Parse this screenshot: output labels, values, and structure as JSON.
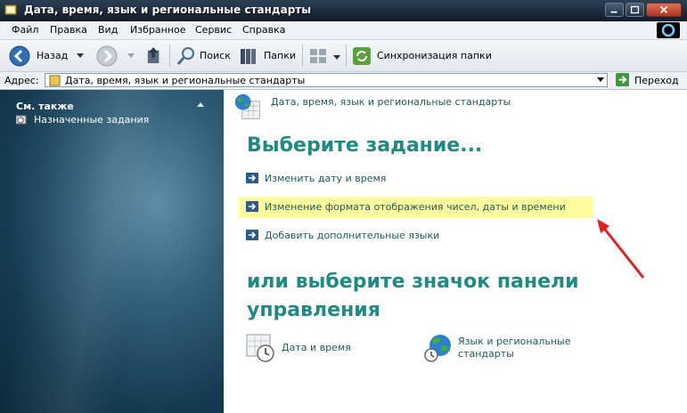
{
  "window": {
    "title": "Дата, время, язык и региональные стандарты"
  },
  "menu": [
    "Файл",
    "Правка",
    "Вид",
    "Избранное",
    "Сервис",
    "Справка"
  ],
  "toolbar": {
    "back_label": "Назад",
    "search_label": "Поиск",
    "folders_label": "Папки",
    "sync_label": "Синхронизация папки"
  },
  "address": {
    "label": "Адрес:",
    "value": "Дата, время, язык и региональные стандарты",
    "go_label": "Переход"
  },
  "sidebar": {
    "see_also": "См. также",
    "items": [
      {
        "label": "Назначенные задания"
      }
    ]
  },
  "content": {
    "breadcrumb": "Дата, время, язык и региональные стандарты",
    "pick_task_heading": "Выберите задание...",
    "tasks": [
      {
        "label": "Изменить дату и время"
      },
      {
        "label": "Изменение формата отображения чисел, даты и времени",
        "highlighted": true
      },
      {
        "label": "Добавить дополнительные языки"
      }
    ],
    "pick_icon_heading": "или выберите значок панели управления",
    "icons": [
      {
        "label": "Дата и время",
        "icon": "date-time-icon"
      },
      {
        "label": "Язык и региональные стандарты",
        "icon": "regional-settings-icon"
      }
    ]
  },
  "colors": {
    "heading": "#1f8a82",
    "link": "#1a5c55",
    "highlight": "#fdfda0",
    "annotation_arrow": "#e02020"
  }
}
